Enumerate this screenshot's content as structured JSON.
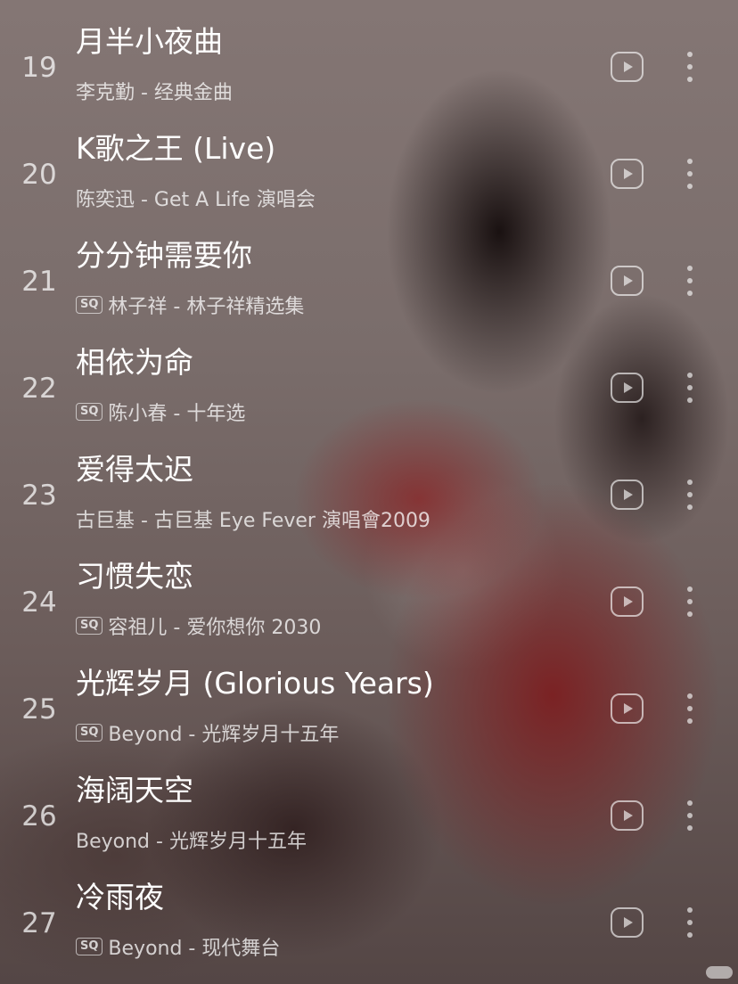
{
  "songs": [
    {
      "number": "19",
      "title": "月半小夜曲",
      "sq": false,
      "sq_label": "",
      "subtitle": "李克勤 - 经典金曲"
    },
    {
      "number": "20",
      "title": "K歌之王 (Live)",
      "sq": false,
      "sq_label": "",
      "subtitle": "陈奕迅 - Get A Life 演唱会"
    },
    {
      "number": "21",
      "title": "分分钟需要你",
      "sq": true,
      "sq_label": "SQ",
      "subtitle": "林子祥 - 林子祥精选集"
    },
    {
      "number": "22",
      "title": "相依为命",
      "sq": true,
      "sq_label": "SQ",
      "subtitle": "陈小春 - 十年选"
    },
    {
      "number": "23",
      "title": "爱得太迟",
      "sq": false,
      "sq_label": "",
      "subtitle": "古巨基 - 古巨基 Eye Fever 演唱會2009"
    },
    {
      "number": "24",
      "title": "习惯失恋",
      "sq": true,
      "sq_label": "SQ",
      "subtitle": "容祖儿 - 爱你想你 2030"
    },
    {
      "number": "25",
      "title": "光辉岁月 (Glorious Years)",
      "sq": true,
      "sq_label": "SQ",
      "subtitle": "Beyond - 光辉岁月十五年"
    },
    {
      "number": "26",
      "title": "海阔天空",
      "sq": false,
      "sq_label": "",
      "subtitle": "Beyond - 光辉岁月十五年"
    },
    {
      "number": "27",
      "title": "冷雨夜",
      "sq": true,
      "sq_label": "SQ",
      "subtitle": "Beyond - 现代舞台"
    }
  ],
  "icons": {
    "play": "play-video-icon",
    "more": "more-vertical-icon"
  },
  "colors": {
    "text_primary": "#ffffff",
    "text_secondary": "rgba(255,255,255,0.75)"
  }
}
